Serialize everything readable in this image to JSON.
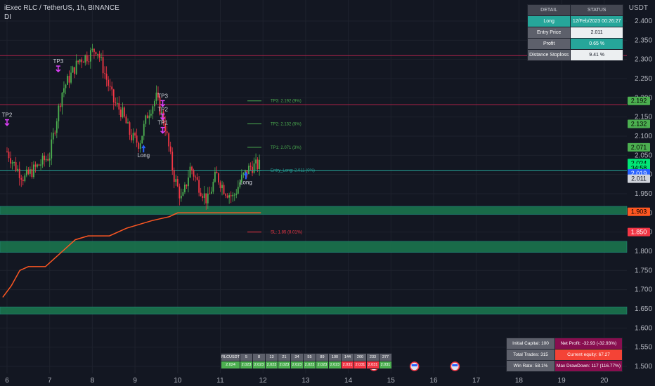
{
  "header": {
    "title": "iExec RLC / TetherUS, 1h, BINANCE",
    "indicator": "DI",
    "unit": "USDT"
  },
  "detail_table": {
    "headers": [
      "DETAIL",
      "STATUS"
    ],
    "rows": [
      {
        "label": "Long",
        "value": "12/Feb/2023 00:26:27"
      },
      {
        "label": "Entry Price",
        "value": "2.011"
      },
      {
        "label": "Profit",
        "value": "0.65 %"
      },
      {
        "label": "Distance Stoploss",
        "value": "9.41 %"
      }
    ]
  },
  "stats_table": {
    "rows": [
      {
        "label": "Initial Capital: 100",
        "value": "Net Profit: -32.93 (-32.93%)"
      },
      {
        "label": "Total Trades: 315",
        "value": "Current equity: 67.27"
      },
      {
        "label": "Win Rate: 58.1%",
        "value": "Max DrawDown: 117 (116.77%)"
      }
    ]
  },
  "fib_table": {
    "headers": [
      "RLCUSDT",
      "5",
      "8",
      "13",
      "21",
      "34",
      "55",
      "89",
      "100",
      "144",
      "200",
      "233",
      "377"
    ],
    "values": [
      "2.024",
      "2.023",
      "2.023",
      "2.023",
      "2.023",
      "2.023",
      "2.023",
      "2.023",
      "2.023",
      "2.031",
      "2.031",
      "2.031",
      "2.031"
    ]
  },
  "colors": {
    "background": "#131722",
    "up": "#4caf50",
    "down": "#f23645",
    "zone": "#1b7a50",
    "stop_line": "#ff5722"
  },
  "chart_data": {
    "type": "candlestick",
    "title": "iExec RLC / TetherUS, 1h, BINANCE",
    "ylim": [
      1.48,
      2.43
    ],
    "y_ticks": [
      1.5,
      1.55,
      1.6,
      1.65,
      1.7,
      1.75,
      1.8,
      1.85,
      1.9,
      1.95,
      2.0,
      2.05,
      2.1,
      2.15,
      2.2,
      2.25,
      2.3,
      2.35,
      2.4
    ],
    "x_ticks": [
      "6",
      "7",
      "8",
      "9",
      "10",
      "11",
      "12",
      "13",
      "14",
      "15",
      "16",
      "17",
      "18",
      "19",
      "20"
    ],
    "price_path": [
      {
        "day": 6.0,
        "price": 2.06
      },
      {
        "day": 6.2,
        "price": 2.02
      },
      {
        "day": 6.4,
        "price": 1.99
      },
      {
        "day": 6.6,
        "price": 2.01
      },
      {
        "day": 6.8,
        "price": 2.03
      },
      {
        "day": 7.0,
        "price": 2.05
      },
      {
        "day": 7.15,
        "price": 2.14
      },
      {
        "day": 7.3,
        "price": 2.22
      },
      {
        "day": 7.5,
        "price": 2.26
      },
      {
        "day": 7.7,
        "price": 2.3
      },
      {
        "day": 7.9,
        "price": 2.31
      },
      {
        "day": 8.1,
        "price": 2.33
      },
      {
        "day": 8.3,
        "price": 2.26
      },
      {
        "day": 8.5,
        "price": 2.19
      },
      {
        "day": 8.7,
        "price": 2.16
      },
      {
        "day": 8.9,
        "price": 2.1
      },
      {
        "day": 9.1,
        "price": 2.08
      },
      {
        "day": 9.3,
        "price": 2.16
      },
      {
        "day": 9.5,
        "price": 2.2
      },
      {
        "day": 9.7,
        "price": 2.13
      },
      {
        "day": 9.9,
        "price": 2.0
      },
      {
        "day": 10.1,
        "price": 1.93
      },
      {
        "day": 10.3,
        "price": 2.02
      },
      {
        "day": 10.5,
        "price": 1.97
      },
      {
        "day": 10.7,
        "price": 1.93
      },
      {
        "day": 10.9,
        "price": 2.0
      },
      {
        "day": 11.1,
        "price": 1.96
      },
      {
        "day": 11.3,
        "price": 1.94
      },
      {
        "day": 11.5,
        "price": 1.99
      },
      {
        "day": 11.7,
        "price": 2.02
      },
      {
        "day": 11.9,
        "price": 2.024
      }
    ],
    "stop_line": [
      {
        "day": 5.9,
        "price": 1.68
      },
      {
        "day": 6.1,
        "price": 1.71
      },
      {
        "day": 6.3,
        "price": 1.75
      },
      {
        "day": 6.5,
        "price": 1.76
      },
      {
        "day": 6.7,
        "price": 1.76
      },
      {
        "day": 6.9,
        "price": 1.76
      },
      {
        "day": 7.0,
        "price": 1.77
      },
      {
        "day": 7.3,
        "price": 1.8
      },
      {
        "day": 7.6,
        "price": 1.83
      },
      {
        "day": 7.9,
        "price": 1.84
      },
      {
        "day": 8.4,
        "price": 1.84
      },
      {
        "day": 8.8,
        "price": 1.86
      },
      {
        "day": 9.4,
        "price": 1.88
      },
      {
        "day": 9.8,
        "price": 1.89
      },
      {
        "day": 10.0,
        "price": 1.9
      },
      {
        "day": 11.0,
        "price": 1.9
      },
      {
        "day": 11.95,
        "price": 1.9
      }
    ],
    "zones": [
      {
        "low": 1.896,
        "high": 1.917
      },
      {
        "low": 1.797,
        "high": 1.826
      },
      {
        "low": 1.636,
        "high": 1.655
      }
    ],
    "horizontal_lines": [
      {
        "price": 2.31,
        "color": "#b2224a"
      },
      {
        "price": 2.182,
        "color": "#b2224a"
      },
      {
        "price": 2.011,
        "color": "#26a69a"
      }
    ],
    "levels": [
      {
        "label": "TP3: 2.192 (9%)",
        "price": 2.192,
        "color": "#4caf50"
      },
      {
        "label": "TP2: 2.132 (6%)",
        "price": 2.132,
        "color": "#4caf50"
      },
      {
        "label": "TP1: 2.071 (3%)",
        "price": 2.071,
        "color": "#4caf50"
      },
      {
        "label": "Entry_Long: 2.011 (0%)",
        "price": 2.011,
        "color": "#26a69a"
      },
      {
        "label": "SL: 1.85 (8.01%)",
        "price": 1.85,
        "color": "#f23645"
      }
    ],
    "price_badges": [
      {
        "label": "2.192",
        "price": 2.192,
        "color": "#4caf50",
        "text": "#000000"
      },
      {
        "label": "2.132",
        "price": 2.132,
        "color": "#4caf50",
        "text": "#000000"
      },
      {
        "label": "2.071",
        "price": 2.071,
        "color": "#4caf50",
        "text": "#000000"
      },
      {
        "label": "2.024",
        "price": 2.03,
        "color": "#00e676",
        "text": "#000000"
      },
      {
        "label": "34:58",
        "price": 2.017,
        "color": "#00e676",
        "text": "#000000"
      },
      {
        "label": "2.019",
        "price": 2.003,
        "color": "#2962ff",
        "text": "#ffffff"
      },
      {
        "label": "2.011",
        "price": 1.989,
        "color": "#d1d4dc",
        "text": "#131722"
      },
      {
        "label": "1.903",
        "price": 1.903,
        "color": "#ff5722",
        "text": "#000000"
      },
      {
        "label": "1.850",
        "price": 1.85,
        "color": "#f23645",
        "text": "#ffffff"
      }
    ],
    "markers": [
      {
        "label": "TP3",
        "day": 7.2,
        "price": 2.29
      },
      {
        "label": "TP2",
        "day": 6.0,
        "price": 2.15
      },
      {
        "label": "TP3",
        "day": 9.65,
        "price": 2.2
      },
      {
        "label": "TP2",
        "day": 9.65,
        "price": 2.165
      },
      {
        "label": "TP1",
        "day": 9.65,
        "price": 2.13
      },
      {
        "label": "Long",
        "day": 9.2,
        "price": 2.045
      },
      {
        "label": "Long",
        "day": 11.6,
        "price": 1.975
      }
    ]
  }
}
